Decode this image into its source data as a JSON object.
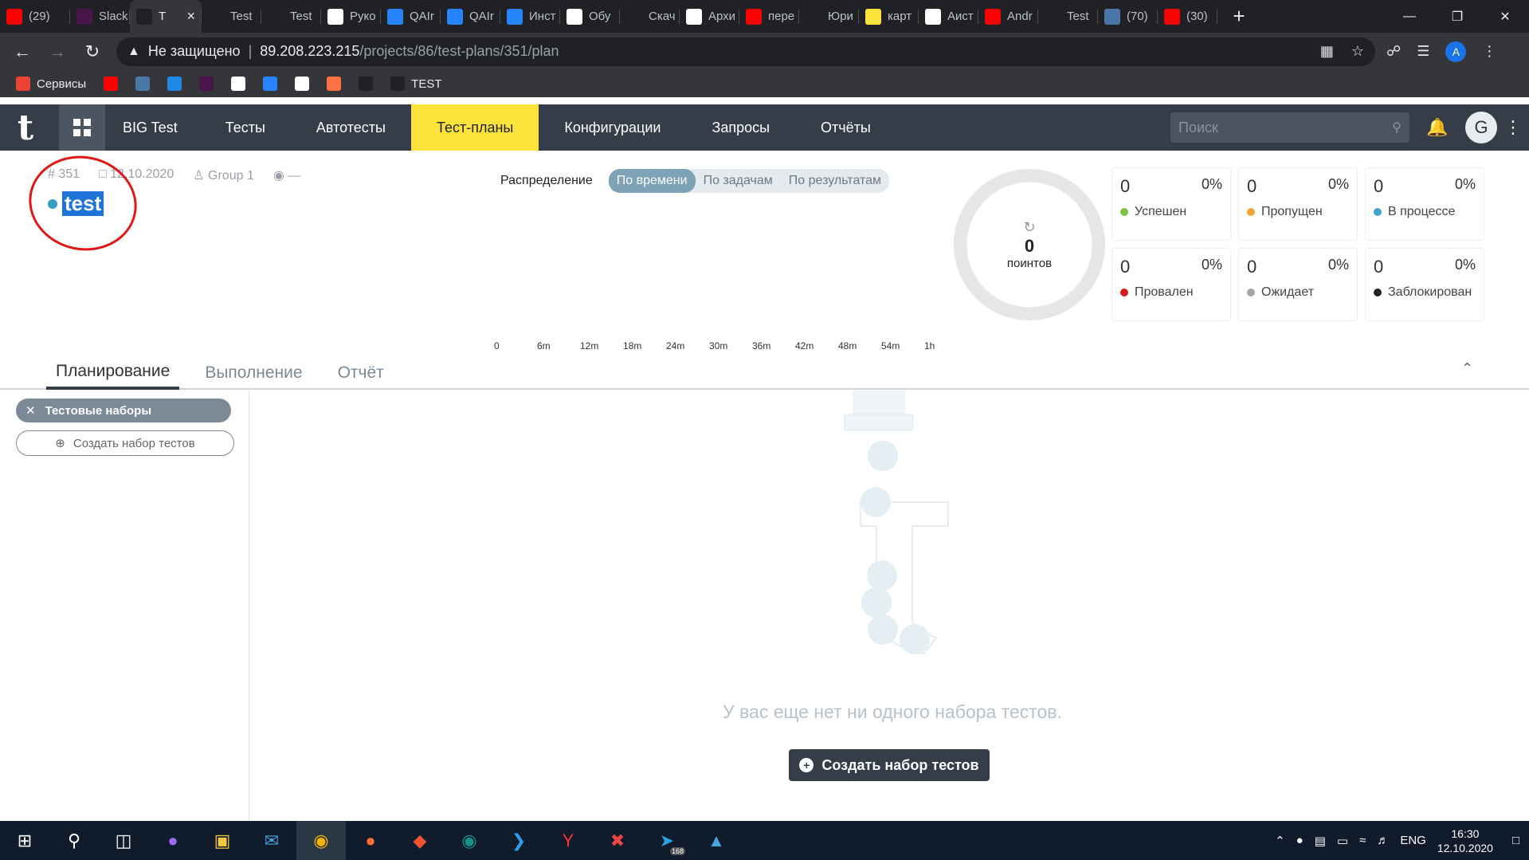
{
  "browser": {
    "tabs": [
      {
        "label": "(29)",
        "icon": "youtube-icon",
        "color": "#ff0000"
      },
      {
        "label": "Slack",
        "icon": "slack-icon",
        "color": "#4a154b"
      },
      {
        "label": "T",
        "icon": "testit-icon",
        "color": "#202124",
        "active": true
      },
      {
        "label": "Test",
        "icon": "testit-icon",
        "color": "#202124"
      },
      {
        "label": "Test",
        "icon": "testit-icon",
        "color": "#202124"
      },
      {
        "label": "Руко",
        "icon": "testit-t-icon",
        "color": "#ffffff"
      },
      {
        "label": "QAIr",
        "icon": "jira-icon",
        "color": "#2684ff"
      },
      {
        "label": "QAIr",
        "icon": "jira-icon",
        "color": "#2684ff"
      },
      {
        "label": "Инст",
        "icon": "confluence-icon",
        "color": "#2684ff"
      },
      {
        "label": "Обу",
        "icon": "openai-icon",
        "color": "#ffffff"
      },
      {
        "label": "Скач",
        "icon": "testit-icon",
        "color": "#202124"
      },
      {
        "label": "Архи",
        "icon": "testit-t-icon",
        "color": "#ffffff"
      },
      {
        "label": "пере",
        "icon": "yandex-icon",
        "color": "#ff0000"
      },
      {
        "label": "Юри",
        "icon": "star-icon",
        "color": "#202124"
      },
      {
        "label": "карт",
        "icon": "map-icon",
        "color": "#fce33b"
      },
      {
        "label": "Аист",
        "icon": "page-icon",
        "color": "#ffffff"
      },
      {
        "label": "Andr",
        "icon": "yandex-icon",
        "color": "#ff0000"
      },
      {
        "label": "Test",
        "icon": "testit-icon",
        "color": "#202124"
      },
      {
        "label": "(70)",
        "icon": "vk-icon",
        "color": "#4a76a8"
      },
      {
        "label": "(30)",
        "icon": "youtube-icon",
        "color": "#ff0000"
      }
    ],
    "not_secure": "Не защищено",
    "host": "89.208.223.215",
    "path": "/projects/86/test-plans/351/plan",
    "profile_initial": "A",
    "bookmarks": [
      {
        "label": "Сервисы",
        "icon": "apps-icon",
        "color": "#ea4335"
      },
      {
        "label": "",
        "icon": "youtube-icon",
        "color": "#ff0000"
      },
      {
        "label": "",
        "icon": "vk-icon",
        "color": "#4a76a8"
      },
      {
        "label": "",
        "icon": "check-icon",
        "color": "#1e88e5"
      },
      {
        "label": "",
        "icon": "slack-icon",
        "color": "#4a154b"
      },
      {
        "label": "",
        "icon": "openai-icon",
        "color": "#ffffff"
      },
      {
        "label": "",
        "icon": "jira-icon",
        "color": "#2684ff"
      },
      {
        "label": "",
        "icon": "github-icon",
        "color": "#ffffff"
      },
      {
        "label": "",
        "icon": "target-icon",
        "color": "#ff7043"
      },
      {
        "label": "",
        "icon": "testit-icon",
        "color": "#202124"
      },
      {
        "label": "TEST",
        "icon": "testit-icon",
        "color": "#202124"
      }
    ]
  },
  "app": {
    "project": "BIG Test",
    "nav": [
      "Тесты",
      "Автотесты",
      "Тест-планы",
      "Конфигурации",
      "Запросы",
      "Отчёты"
    ],
    "active_nav": "Тест-планы",
    "search_placeholder": "Поиск",
    "user_initial": "G"
  },
  "plan": {
    "id": "# 351",
    "date": "12.10.2020",
    "group": "Group 1",
    "tag": "—",
    "title": "test"
  },
  "distribution": {
    "label": "Распределение",
    "options": [
      "По времени",
      "По задачам",
      "По результатам"
    ],
    "selected": "По времени",
    "axis_ticks": [
      "0",
      "6m",
      "12m",
      "18m",
      "24m",
      "30m",
      "36m",
      "42m",
      "48m",
      "54m",
      "1h"
    ]
  },
  "summary": {
    "points": "0",
    "points_label": "поинтов",
    "statuses": [
      {
        "count": "0",
        "percent": "0%",
        "label": "Успешен",
        "color": "#7cc243"
      },
      {
        "count": "0",
        "percent": "0%",
        "label": "Пропущен",
        "color": "#f2a531"
      },
      {
        "count": "0",
        "percent": "0%",
        "label": "В процессе",
        "color": "#3ea7c7"
      },
      {
        "count": "0",
        "percent": "0%",
        "label": "Провален",
        "color": "#d31b1b"
      },
      {
        "count": "0",
        "percent": "0%",
        "label": "Ожидает",
        "color": "#a4a4a4"
      },
      {
        "count": "0",
        "percent": "0%",
        "label": "Заблокирован",
        "color": "#222222"
      }
    ]
  },
  "tabs": [
    "Планирование",
    "Выполнение",
    "Отчёт"
  ],
  "active_tab": "Планирование",
  "sidebar": {
    "filter_chip": "Тестовые наборы",
    "create_button": "Создать набор тестов"
  },
  "empty_state": {
    "message": "У вас еще нет ни одного набора тестов.",
    "button": "Создать набор тестов"
  },
  "taskbar": {
    "language": "ENG",
    "time": "16:30",
    "date": "12.10.2020",
    "telegram_badge": "168"
  }
}
